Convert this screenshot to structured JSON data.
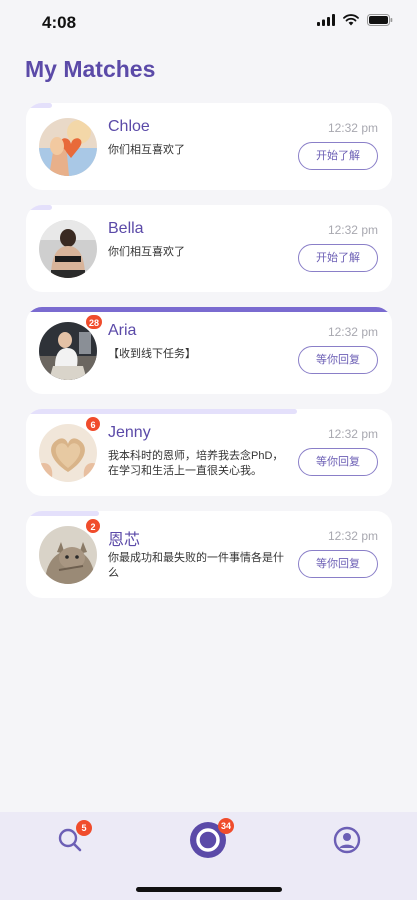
{
  "status_bar": {
    "time": "4:08"
  },
  "page": {
    "title": "My Matches"
  },
  "matches": [
    {
      "name": "Chloe",
      "message": "你们相互喜欢了",
      "time": "12:32 pm",
      "action": "开始了解",
      "badge": "",
      "progress": 0.07,
      "avatar": "woman-with-heart-balloon"
    },
    {
      "name": "Bella",
      "message": "你们相互喜欢了",
      "time": "12:32 pm",
      "action": "开始了解",
      "badge": "",
      "progress": 0.07,
      "avatar": "woman-back-view"
    },
    {
      "name": "Aria",
      "message": "【收到线下任务】",
      "time": "12:32 pm",
      "action": "等你回复",
      "badge": "28",
      "progress": 1.0,
      "avatar": "woman-sitting"
    },
    {
      "name": "Jenny",
      "message": "我本科时的恩师，培养我去念PhD，在学习和生活上一直很关心我。",
      "time": "12:32 pm",
      "action": "等你回复",
      "badge": "6",
      "progress": 0.74,
      "avatar": "heart-shaped-bread"
    },
    {
      "name": "恩芯",
      "message": "你最成功和最失败的一件事情各是什么",
      "time": "12:32 pm",
      "action": "等你回复",
      "badge": "2",
      "progress": 0.2,
      "avatar": "cat"
    }
  ],
  "bottom_nav": {
    "items": [
      {
        "name": "search",
        "icon": "search-icon",
        "badge": "5"
      },
      {
        "name": "matches",
        "icon": "chat-ring-icon",
        "badge": "34"
      },
      {
        "name": "profile",
        "icon": "profile-icon",
        "badge": ""
      }
    ]
  },
  "colors": {
    "accent": "#5b4aa8",
    "progress_full": "#7a6bd0",
    "progress_partial": "#e4e0fb",
    "badge": "#f04c2c"
  }
}
